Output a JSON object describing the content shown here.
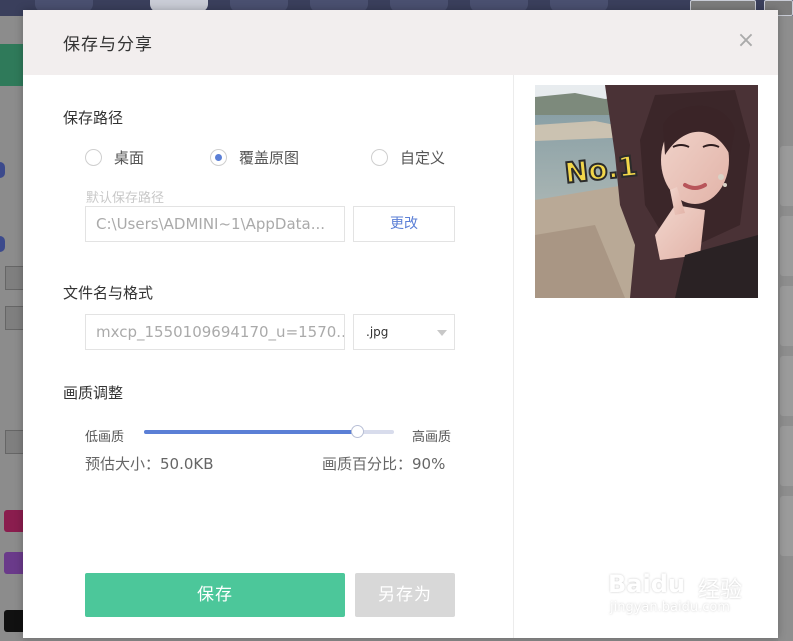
{
  "dialog": {
    "title": "保存与分享",
    "close_glyph": "×"
  },
  "save_path": {
    "section_title": "保存路径",
    "options": [
      {
        "label": "桌面",
        "checked": false
      },
      {
        "label": "覆盖原图",
        "checked": true
      },
      {
        "label": "自定义",
        "checked": false
      }
    ],
    "default_label": "默认保存路径",
    "path_value": "C:\\Users\\ADMINI~1\\AppData...",
    "change_button": "更改"
  },
  "file": {
    "section_title": "文件名与格式",
    "name_value": "mxcp_1550109694170_u=1570...",
    "format_value": ".jpg"
  },
  "quality": {
    "section_title": "画质调整",
    "low_label": "低画质",
    "high_label": "高画质",
    "value_fraction": 0.85,
    "estimated_size": "预估大小：50.0KB",
    "percent_text": "画质百分比：90%"
  },
  "buttons": {
    "save": "保存",
    "save_as": "另存为"
  },
  "preview": {
    "sticker_text": "No.1"
  },
  "watermark": {
    "brand": "Baidu",
    "brand_cn": "经验",
    "site": "jingyan.baidu.com"
  },
  "colors": {
    "accent": "#5b7fd6",
    "save_button": "#4cc79a",
    "disabled_button": "#d8d8d8"
  }
}
